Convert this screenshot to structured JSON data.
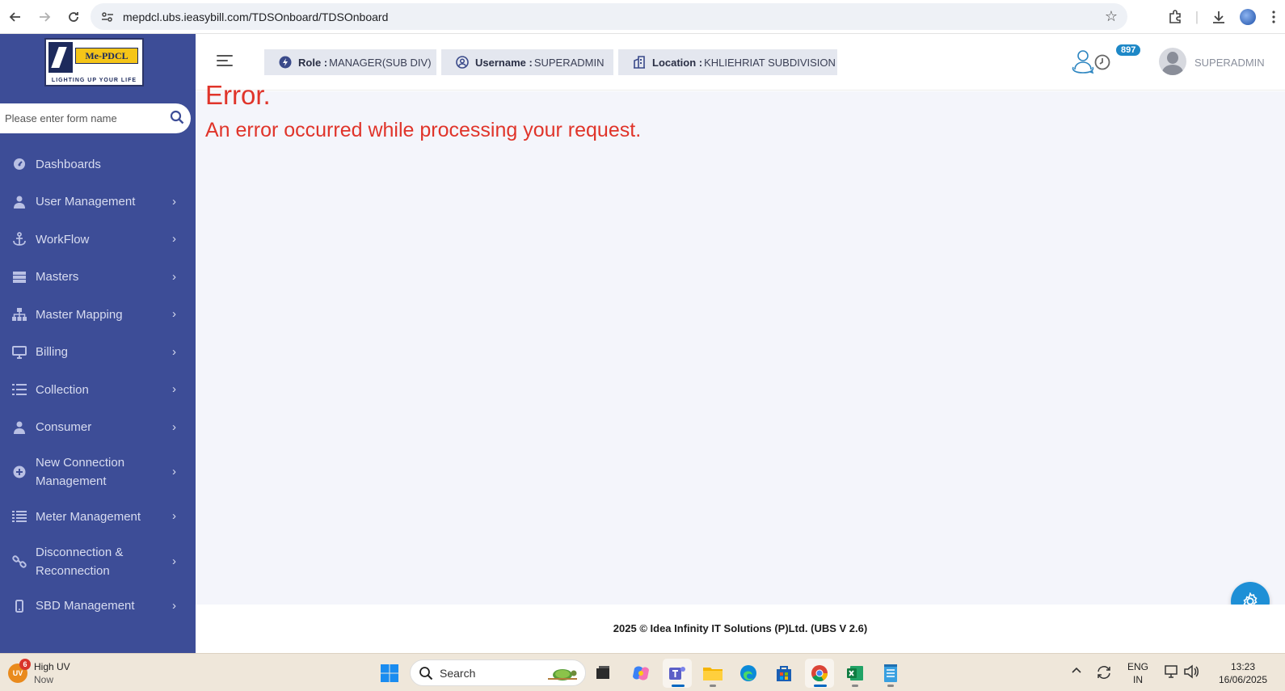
{
  "browser": {
    "url": "mepdcl.ubs.ieasybill.com/TDSOnboard/TDSOnboard"
  },
  "logo": {
    "name": "Me-PDCL",
    "tagline": "LIGHTING UP YOUR LIFE"
  },
  "sidebar": {
    "search_placeholder": "Please enter form name",
    "items": [
      {
        "label": "Dashboards",
        "icon": "gauge-icon",
        "has_submenu": false
      },
      {
        "label": "User Management",
        "icon": "user-icon",
        "has_submenu": true
      },
      {
        "label": "WorkFlow",
        "icon": "anchor-icon",
        "has_submenu": true
      },
      {
        "label": "Masters",
        "icon": "server-icon",
        "has_submenu": true
      },
      {
        "label": "Master Mapping",
        "icon": "sitemap-icon",
        "has_submenu": true
      },
      {
        "label": "Billing",
        "icon": "desktop-icon",
        "has_submenu": true
      },
      {
        "label": "Collection",
        "icon": "list-icon",
        "has_submenu": true
      },
      {
        "label": "Consumer",
        "icon": "user-icon",
        "has_submenu": true
      },
      {
        "label": "New Connection Management",
        "icon": "plus-circle-icon",
        "has_submenu": true
      },
      {
        "label": "Meter Management",
        "icon": "list-icon",
        "has_submenu": true
      },
      {
        "label": "Disconnection & Reconnection",
        "icon": "link-icon",
        "has_submenu": true
      },
      {
        "label": "SBD Management",
        "icon": "mobile-icon",
        "has_submenu": true
      }
    ]
  },
  "header": {
    "role_label": "Role :",
    "role_value": "MANAGER(SUB DIV)",
    "username_label": "Username :",
    "username_value": "SUPERADMIN",
    "location_label": "Location :",
    "location_value": "KHLIEHRIAT SUBDIVISION",
    "notification_count": "897",
    "user_name": "SUPERADMIN"
  },
  "content": {
    "error_title": "Error.",
    "error_message": "An error occurred while processing your request."
  },
  "footer": {
    "text": "2025 © Idea Infinity IT Solutions (P)Ltd. (UBS V 2.6)"
  },
  "taskbar": {
    "weather_title": "High UV",
    "weather_sub": "Now",
    "weather_icon_text": "UV",
    "weather_badge": "6",
    "search_label": "Search",
    "lang_top": "ENG",
    "lang_bottom": "IN",
    "time": "13:23",
    "date": "16/06/2025"
  },
  "colors": {
    "sidebar_bg": "#3d4d97",
    "error_red": "#e0342a",
    "accent_blue": "#1e8fd6",
    "badge_blue": "#1e88c7"
  }
}
